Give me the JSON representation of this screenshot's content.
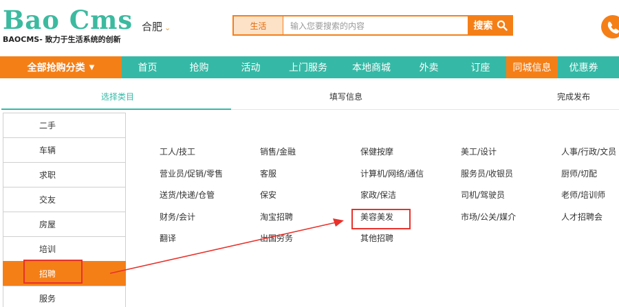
{
  "header": {
    "logo": "Bao Cms",
    "slogan": "BAOCMS- 致力于生活系统的创新",
    "city": "合肥",
    "search": {
      "category": "生活",
      "placeholder": "输入您要搜索的内容",
      "button": "搜索"
    }
  },
  "nav": {
    "all_categories": "全部抢购分类",
    "items": [
      "首页",
      "抢购",
      "活动",
      "上门服务",
      "本地商城",
      "外卖",
      "订座",
      "同城信息",
      "优惠券"
    ],
    "active_index": 7
  },
  "steps": [
    "选择类目",
    "填写信息",
    "完成发布"
  ],
  "steps_active_index": 0,
  "sidebar": {
    "items": [
      "二手",
      "车辆",
      "求职",
      "交友",
      "房屋",
      "培训",
      "招聘",
      "服务"
    ],
    "active_index": 6
  },
  "subcategories": [
    [
      "工人/技工",
      "销售/金融",
      "保健按摩",
      "美工/设计",
      "人事/行政/文员"
    ],
    [
      "营业员/促销/零售",
      "客服",
      "计算机/网络/通信",
      "服务员/收银员",
      "厨师/切配"
    ],
    [
      "送货/快递/仓管",
      "保安",
      "家政/保洁",
      "司机/驾驶员",
      "老师/培训师"
    ],
    [
      "财务/会计",
      "淘宝招聘",
      "美容美发",
      "市场/公关/媒介",
      "人才招聘会"
    ],
    [
      "翻译",
      "出国劳务",
      "其他招聘"
    ]
  ],
  "highlighted_subcategory": "美容美发",
  "colors": {
    "teal": "#35b9a6",
    "orange": "#f57f17",
    "annotation_red": "#e8312a"
  }
}
